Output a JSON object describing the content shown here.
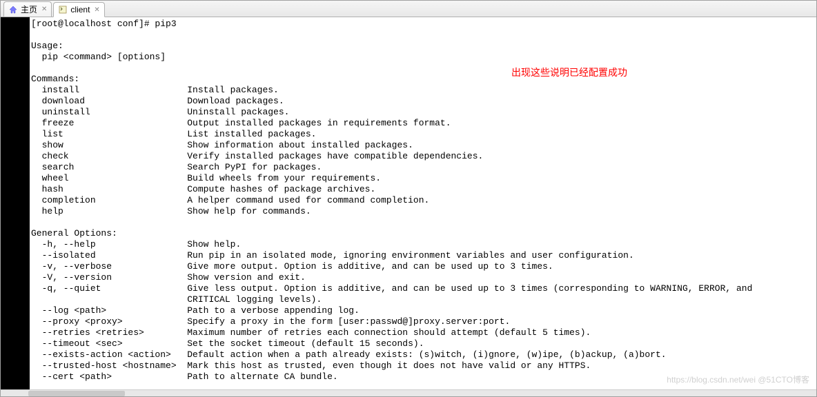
{
  "tabs": [
    {
      "label": "主页",
      "icon": "home"
    },
    {
      "label": "client",
      "icon": "shell"
    }
  ],
  "annotation": "出现这些说明已经配置成功",
  "watermark": "https://blog.csdn.net/wei @51CTO博客",
  "terminal": {
    "prompt": "[root@localhost conf]# pip3",
    "usage_header": "Usage:",
    "usage_line": "  pip <command> [options]",
    "commands_header": "Commands:",
    "commands": [
      {
        "name": "install",
        "desc": "Install packages."
      },
      {
        "name": "download",
        "desc": "Download packages."
      },
      {
        "name": "uninstall",
        "desc": "Uninstall packages."
      },
      {
        "name": "freeze",
        "desc": "Output installed packages in requirements format."
      },
      {
        "name": "list",
        "desc": "List installed packages."
      },
      {
        "name": "show",
        "desc": "Show information about installed packages."
      },
      {
        "name": "check",
        "desc": "Verify installed packages have compatible dependencies."
      },
      {
        "name": "search",
        "desc": "Search PyPI for packages."
      },
      {
        "name": "wheel",
        "desc": "Build wheels from your requirements."
      },
      {
        "name": "hash",
        "desc": "Compute hashes of package archives."
      },
      {
        "name": "completion",
        "desc": "A helper command used for command completion."
      },
      {
        "name": "help",
        "desc": "Show help for commands."
      }
    ],
    "general_header": "General Options:",
    "options": [
      {
        "flag": "-h, --help",
        "desc": "Show help."
      },
      {
        "flag": "--isolated",
        "desc": "Run pip in an isolated mode, ignoring environment variables and user configuration."
      },
      {
        "flag": "-v, --verbose",
        "desc": "Give more output. Option is additive, and can be used up to 3 times."
      },
      {
        "flag": "-V, --version",
        "desc": "Show version and exit."
      },
      {
        "flag": "-q, --quiet",
        "desc": "Give less output. Option is additive, and can be used up to 3 times (corresponding to WARNING, ERROR, and"
      },
      {
        "flag": "",
        "desc": "CRITICAL logging levels)."
      },
      {
        "flag": "--log <path>",
        "desc": "Path to a verbose appending log."
      },
      {
        "flag": "--proxy <proxy>",
        "desc": "Specify a proxy in the form [user:passwd@]proxy.server:port."
      },
      {
        "flag": "--retries <retries>",
        "desc": "Maximum number of retries each connection should attempt (default 5 times)."
      },
      {
        "flag": "--timeout <sec>",
        "desc": "Set the socket timeout (default 15 seconds)."
      },
      {
        "flag": "--exists-action <action>",
        "desc": "Default action when a path already exists: (s)witch, (i)gnore, (w)ipe, (b)ackup, (a)bort."
      },
      {
        "flag": "--trusted-host <hostname>",
        "desc": "Mark this host as trusted, even though it does not have valid or any HTTPS."
      },
      {
        "flag": "--cert <path>",
        "desc": "Path to alternate CA bundle."
      }
    ]
  }
}
